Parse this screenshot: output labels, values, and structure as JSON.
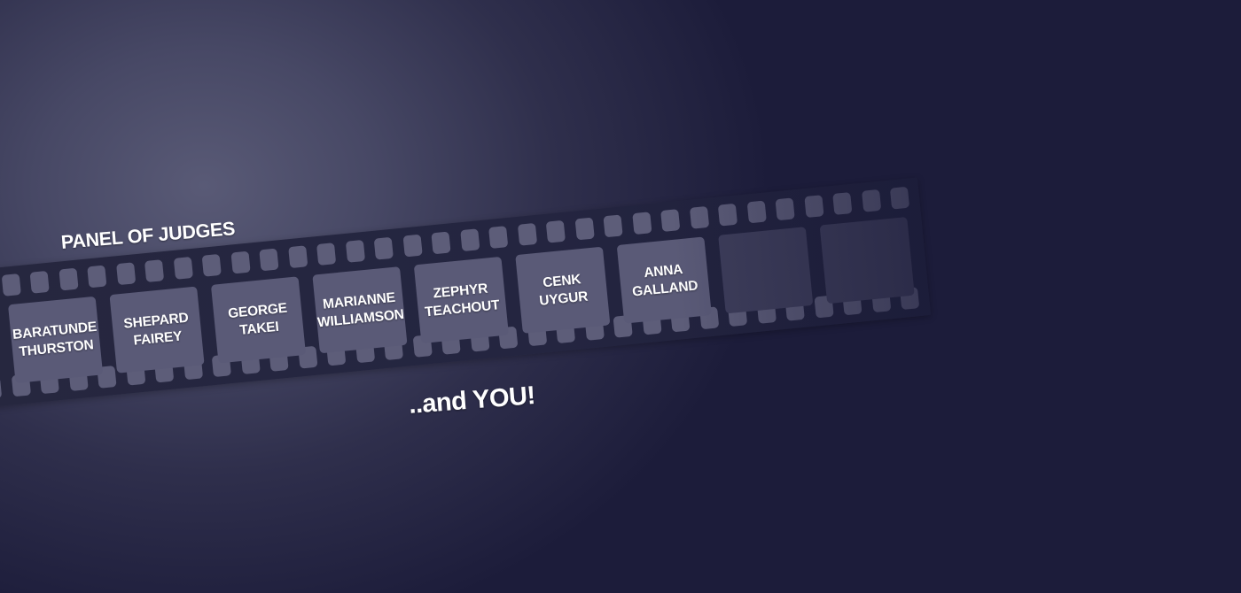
{
  "heading": "PANEL OF JUDGES",
  "closing": "..and YOU!",
  "judges": [
    {
      "first": "BARATUNDE",
      "last": "THURSTON"
    },
    {
      "first": "SHEPARD",
      "last": "FAIREY"
    },
    {
      "first": "GEORGE",
      "last": "TAKEI"
    },
    {
      "first": "MARIANNE",
      "last": "WILLIAMSON"
    },
    {
      "first": "ZEPHYR",
      "last": "TEACHOUT"
    },
    {
      "first": "CENK",
      "last": "UYGUR"
    },
    {
      "first": "ANNA",
      "last": "GALLAND"
    }
  ],
  "empty_frames": 2,
  "colors": {
    "background": "#1b1b38",
    "glow": "#595a76",
    "film": "#26273f",
    "frame": "#5a5a77",
    "frame_empty": "#3e3e5b",
    "text": "#ffffff"
  }
}
